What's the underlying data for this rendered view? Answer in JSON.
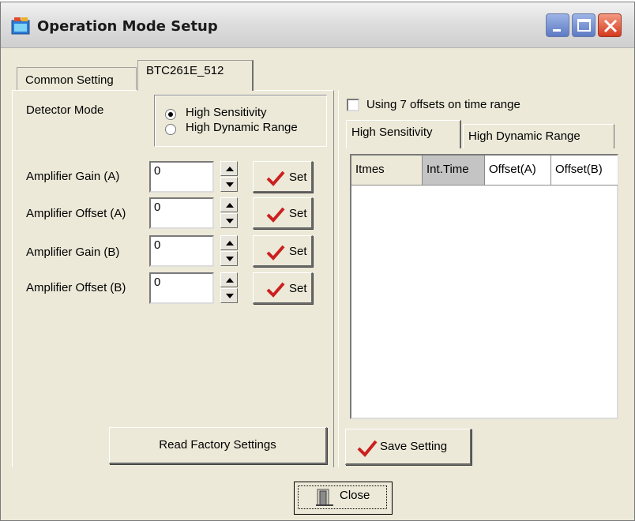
{
  "window": {
    "title": "Operation Mode Setup"
  },
  "outer_tabs": [
    {
      "label": "Common Setting",
      "active": false
    },
    {
      "label": "BTC261E_512",
      "active": true
    }
  ],
  "detector_mode": {
    "label": "Detector Mode",
    "options": [
      {
        "label": "High Sensitivity",
        "selected": true
      },
      {
        "label": "High Dynamic Range",
        "selected": false
      }
    ]
  },
  "amplifiers": [
    {
      "label": "Amplifier Gain (A)",
      "value": "0",
      "button": "Set"
    },
    {
      "label": "Amplifier Offset (A)",
      "value": "0",
      "button": "Set"
    },
    {
      "label": "Amplifier Gain (B)",
      "value": "0",
      "button": "Set"
    },
    {
      "label": "Amplifier Offset (B)",
      "value": "0",
      "button": "Set"
    }
  ],
  "offsets_checkbox": {
    "label": "Using 7 offsets on time range",
    "checked": false
  },
  "inner_tabs": [
    {
      "label": "High Sensitivity",
      "active": true
    },
    {
      "label": "High Dynamic Range",
      "active": false
    }
  ],
  "table": {
    "columns": [
      "Itmes",
      "Int.Time",
      "Offset(A)",
      "Offset(B)"
    ],
    "rows": []
  },
  "buttons": {
    "read_factory": "Read Factory Settings",
    "save_setting": "Save Setting",
    "close": "Close"
  },
  "colors": {
    "check_mark": "#cc1f1f",
    "window_bg": "#ece9d8"
  }
}
